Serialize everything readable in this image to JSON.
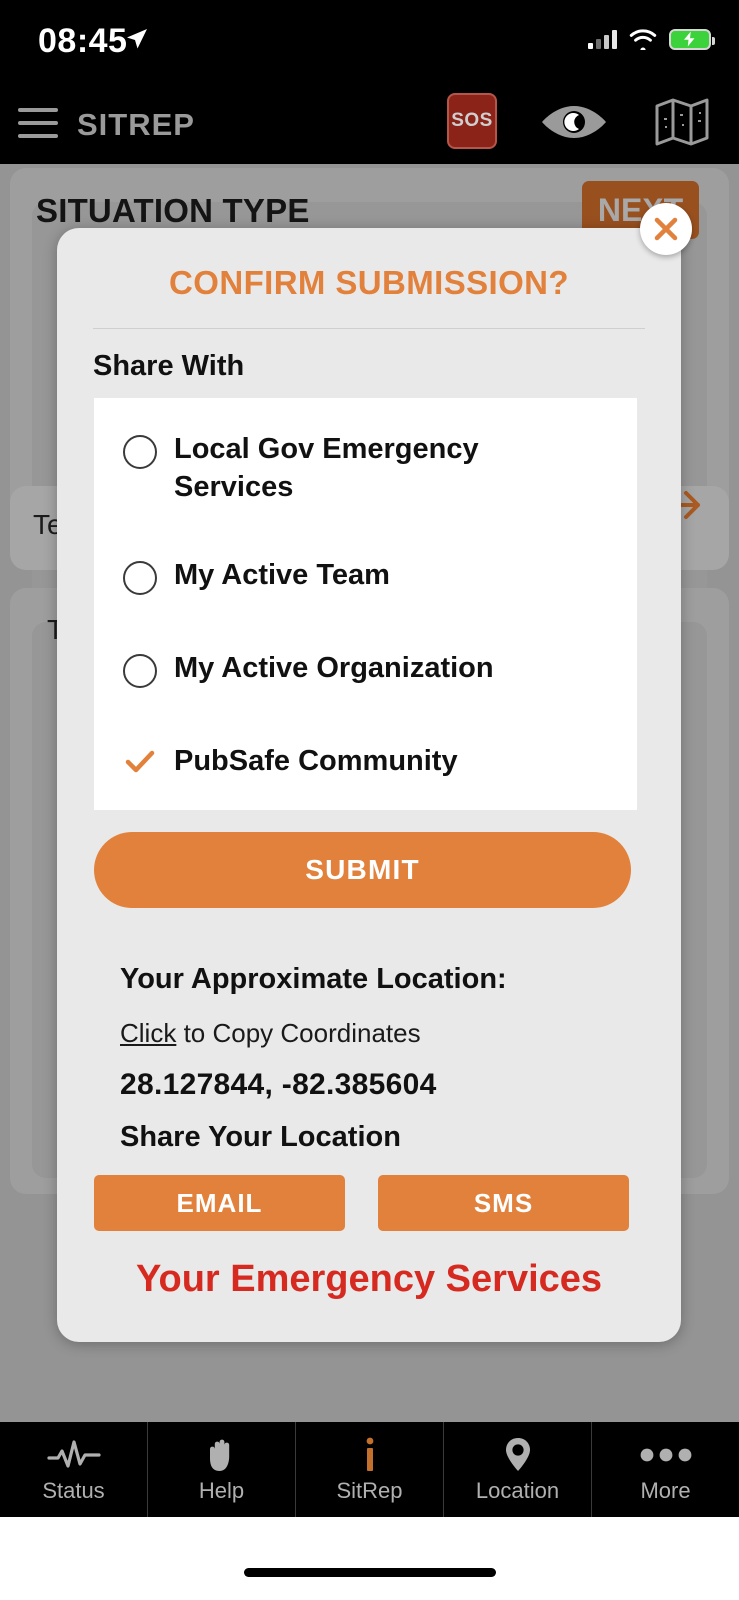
{
  "status_bar": {
    "time": "08:45",
    "location_arrow_icon": "location-arrow-icon",
    "signal_icon": "cellular-signal-icon",
    "wifi_icon": "wifi-icon",
    "battery_icon": "battery-charging-icon"
  },
  "app_bar": {
    "menu_icon": "hamburger-menu-icon",
    "title": "SITREP",
    "sos_label": "SOS",
    "eye_icon": "night-vision-eye-icon",
    "map_icon": "map-icon"
  },
  "background_page": {
    "title": "SITUATION TYPE",
    "next_label": "NEXT",
    "arrow_icon": "arrow-right-icon",
    "partial_text_1": "Te",
    "partial_text_2": "T"
  },
  "modal": {
    "title": "CONFIRM SUBMISSION?",
    "close_icon": "close-x-icon",
    "share_with_label": "Share With",
    "options": [
      {
        "label": "Local Gov Emergency Services",
        "selected": false
      },
      {
        "label": "My Active Team",
        "selected": false
      },
      {
        "label": "My Active Organization",
        "selected": false
      },
      {
        "label": "PubSafe Community",
        "selected": true
      }
    ],
    "submit_label": "SUBMIT",
    "location_heading": "Your Approximate Location:",
    "copy_link_text": "Click",
    "copy_rest_text": " to Copy Coordinates",
    "coordinates": "28.127844, -82.385604",
    "share_location_label": "Share Your Location",
    "email_label": "EMAIL",
    "sms_label": "SMS",
    "emergency_services_text": "Your Emergency Services"
  },
  "tab_bar": {
    "tabs": [
      {
        "label": "Status",
        "icon": "pulse-waveform-icon",
        "active": false
      },
      {
        "label": "Help",
        "icon": "hand-icon",
        "active": false
      },
      {
        "label": "SitRep",
        "icon": "info-i-icon",
        "active": true
      },
      {
        "label": "Location",
        "icon": "map-pin-icon",
        "active": false
      },
      {
        "label": "More",
        "icon": "ellipsis-icon",
        "active": false
      }
    ]
  },
  "colors": {
    "accent_orange": "#E2813C",
    "next_button_orange": "#99501f",
    "emergency_red": "#D62A20",
    "sos_red": "#8c2318",
    "modal_bg": "#e9e9e9",
    "dim_overlay": "#949494"
  }
}
